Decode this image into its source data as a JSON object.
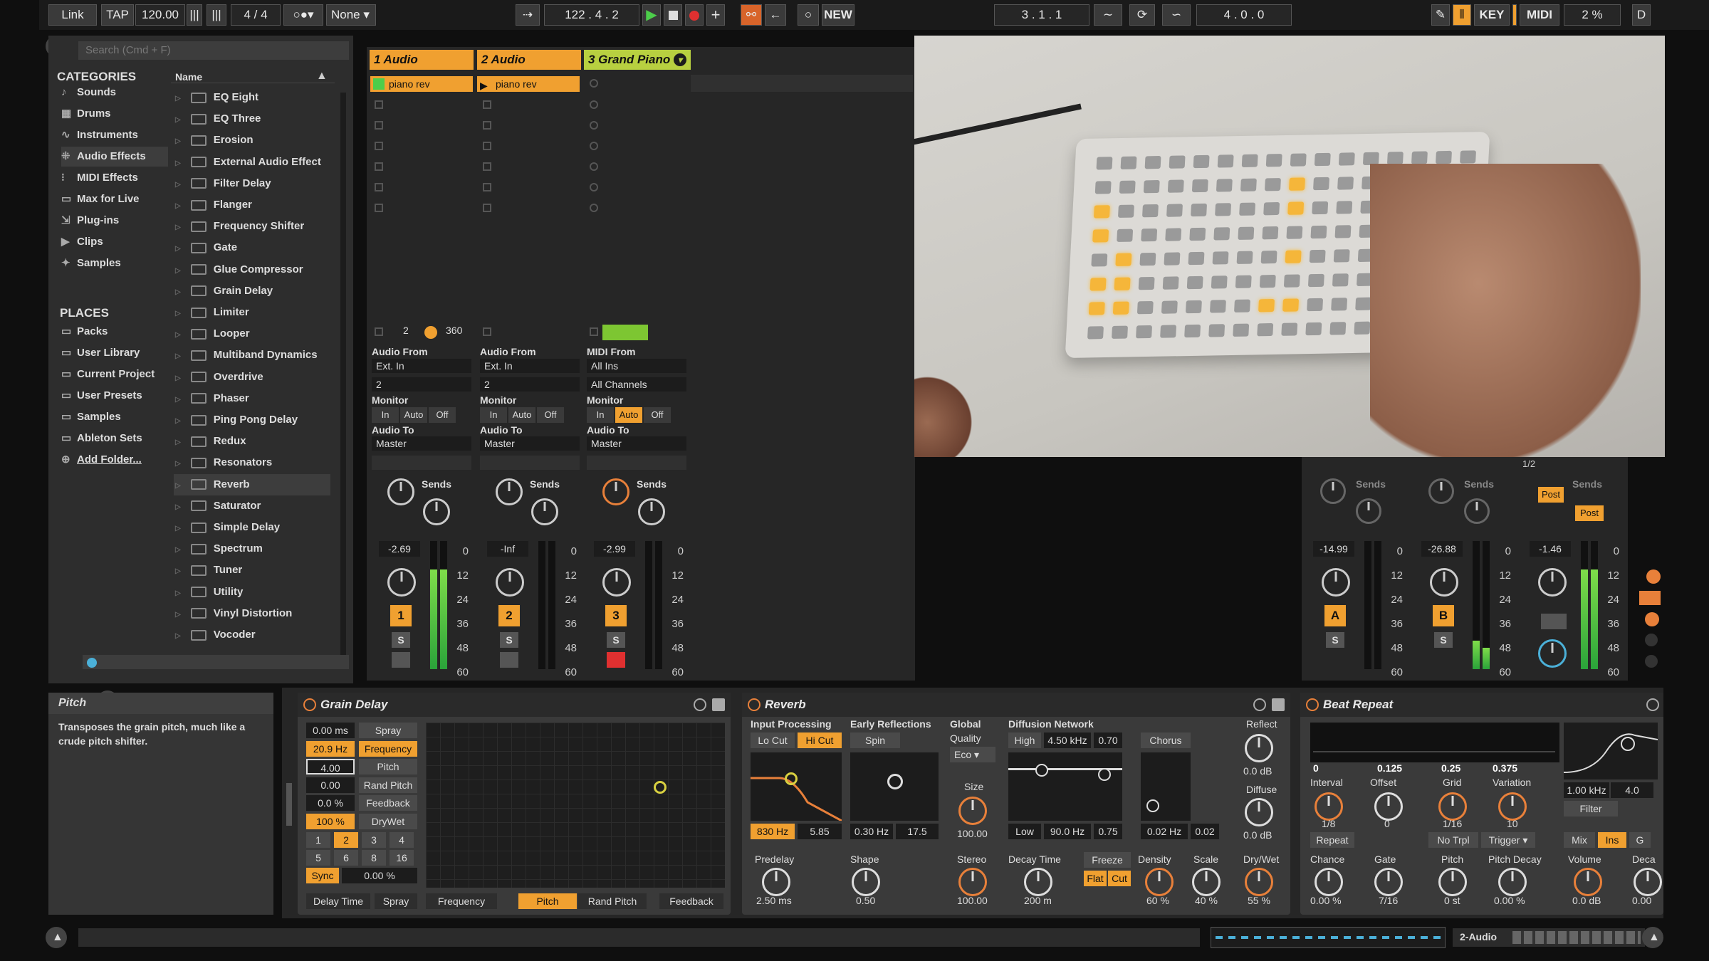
{
  "topbar": {
    "link": "Link",
    "tap": "TAP",
    "tempo": "120.00",
    "signature": "4 / 4",
    "quantize": "None",
    "position": "122 .  4 .  2",
    "new": "NEW",
    "loop_start": "3 .  1 .  1",
    "loop_length": "4 .  0 .  0",
    "key": "KEY",
    "midi": "MIDI",
    "cpu": "2 %",
    "d": "D"
  },
  "browser": {
    "search_placeholder": "Search (Cmd + F)",
    "categories_title": "CATEGORIES",
    "name_header": "Name",
    "categories": [
      "Sounds",
      "Drums",
      "Instruments",
      "Audio Effects",
      "MIDI Effects",
      "Max for Live",
      "Plug-ins",
      "Clips",
      "Samples"
    ],
    "places_title": "PLACES",
    "places": [
      "Packs",
      "User Library",
      "Current Project",
      "User Presets",
      "Samples",
      "Ableton Sets",
      "Add Folder..."
    ],
    "items": [
      "EQ Eight",
      "EQ Three",
      "Erosion",
      "External Audio Effect",
      "Filter Delay",
      "Flanger",
      "Frequency Shifter",
      "Gate",
      "Glue Compressor",
      "Grain Delay",
      "Limiter",
      "Looper",
      "Multiband Dynamics",
      "Overdrive",
      "Phaser",
      "Ping Pong Delay",
      "Redux",
      "Resonators",
      "Reverb",
      "Saturator",
      "Simple Delay",
      "Spectrum",
      "Tuner",
      "Utility",
      "Vinyl Distortion",
      "Vocoder"
    ]
  },
  "tracks": [
    {
      "name": "1 Audio",
      "clip": "piano rev",
      "input_label": "Audio From",
      "input": "Ext. In",
      "channel": "2",
      "monitor_label": "Monitor",
      "monitor": [
        "In",
        "Auto",
        "Off"
      ],
      "out_label": "Audio To",
      "out": "Master",
      "sends": "Sends",
      "vol": "-2.69",
      "number": "1",
      "solo": "S"
    },
    {
      "name": "2 Audio",
      "clip": "piano rev",
      "input_label": "Audio From",
      "input": "Ext. In",
      "channel": "2",
      "monitor_label": "Monitor",
      "monitor": [
        "In",
        "Auto",
        "Off"
      ],
      "out_label": "Audio To",
      "out": "Master",
      "sends": "Sends",
      "vol": "-Inf",
      "number": "2",
      "solo": "S"
    },
    {
      "name": "3 Grand Piano",
      "clip": "",
      "input_label": "MIDI From",
      "input": "All Ins",
      "channel": "All Channels",
      "monitor_label": "Monitor",
      "monitor": [
        "In",
        "Auto",
        "Off"
      ],
      "out_label": "Audio To",
      "out": "Master",
      "sends": "Sends",
      "vol": "-2.99",
      "number": "3",
      "solo": "S"
    }
  ],
  "clip_status": {
    "count": "2",
    "value": "360"
  },
  "returns": [
    {
      "sends": "Sends",
      "vol": "-14.99",
      "letter": "A",
      "solo": "S"
    },
    {
      "sends": "Sends",
      "vol": "-26.88",
      "letter": "B",
      "solo": "S"
    },
    {
      "sends": "Sends",
      "vol": "-1.46",
      "post1": "Post",
      "post2": "Post",
      "cue": "1/2"
    }
  ],
  "meter_scale": [
    "0",
    "12",
    "24",
    "36",
    "48",
    "60"
  ],
  "info": {
    "title": "Pitch",
    "text": "Transposes the grain pitch, much like a crude pitch shifter."
  },
  "grain_delay": {
    "title": "Grain Delay",
    "values": [
      "0.00 ms",
      "20.9 Hz",
      "4.00",
      "0.00",
      "0.0 %",
      "100 %"
    ],
    "labels": [
      "Spray",
      "Frequency",
      "Pitch",
      "Rand Pitch",
      "Feedback",
      "DryWet"
    ],
    "sync_values": [
      "1",
      "2",
      "3",
      "4",
      "5",
      "6",
      "8",
      "16"
    ],
    "sync": "Sync",
    "sync_value": "0.00 %",
    "axis": [
      "Delay Time",
      "Spray",
      "Frequency",
      "Pitch",
      "Rand Pitch",
      "Feedback"
    ]
  },
  "reverb": {
    "title": "Reverb",
    "input_processing": "Input Processing",
    "lo_cut": "Lo Cut",
    "hi_cut": "Hi Cut",
    "early": "Early Reflections",
    "spin": "Spin",
    "global": "Global",
    "quality": "Quality",
    "quality_value": "Eco",
    "size": "Size",
    "size_value": "100.00",
    "diffusion": "Diffusion Network",
    "high": "High",
    "high_freq": "4.50 kHz",
    "high_val": "0.70",
    "chorus": "Chorus",
    "low": "Low",
    "low_freq": "90.0 Hz",
    "low_val": "0.75",
    "chorus_rate": "0.02 Hz",
    "chorus_amt": "0.02",
    "reflect": "Reflect",
    "reflect_val": "0.0 dB",
    "diffuse": "Diffuse",
    "diffuse_val": "0.0 dB",
    "filter_freq": "830 Hz",
    "filter_width": "5.85",
    "spin_rate": "0.30 Hz",
    "spin_amt": "17.5",
    "predelay": "Predelay",
    "predelay_val": "2.50 ms",
    "shape": "Shape",
    "shape_val": "0.50",
    "stereo": "Stereo",
    "stereo_val": "100.00",
    "decay": "Decay Time",
    "decay_val": "200 m",
    "freeze": "Freeze",
    "flat": "Flat",
    "cut": "Cut",
    "density": "Density",
    "density_val": "60 %",
    "scale": "Scale",
    "scale_val": "40 %",
    "drywet": "Dry/Wet",
    "drywet_val": "55 %"
  },
  "beat_repeat": {
    "title": "Beat Repeat",
    "ruler": [
      "0",
      "0.125",
      "0.25",
      "0.375"
    ],
    "interval": "Interval",
    "interval_val": "1/8",
    "offset": "Offset",
    "offset_val": "0",
    "grid": "Grid",
    "grid_val": "1/16",
    "variation": "Variation",
    "variation_val": "10",
    "repeat": "Repeat",
    "no_trpl": "No Trpl",
    "trigger": "Trigger",
    "chance": "Chance",
    "chance_val": "0.00 %",
    "gate": "Gate",
    "gate_val": "7/16",
    "pitch": "Pitch",
    "pitch_val": "0 st",
    "pitch_decay": "Pitch Decay",
    "pitch_decay_val": "0.00 %",
    "filter_freq": "1.00 kHz",
    "filter_w": "4.0",
    "filter": "Filter",
    "mix": "Mix",
    "ins": "Ins",
    "g": "G",
    "volume": "Volume",
    "volume_val": "0.0 dB",
    "decay": "Deca",
    "decay_val": "0.00"
  },
  "status": {
    "track": "2-Audio"
  },
  "colors": {
    "accent": "#f0a030",
    "panel": "#2b2b2b",
    "meter": "#4ccd4a"
  }
}
